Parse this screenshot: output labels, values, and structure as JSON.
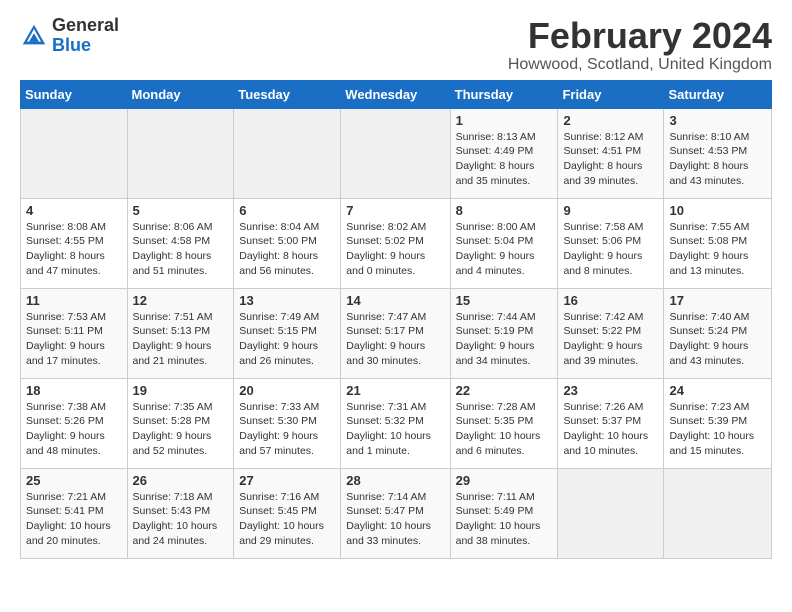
{
  "header": {
    "logo_general": "General",
    "logo_blue": "Blue",
    "month_title": "February 2024",
    "location": "Howwood, Scotland, United Kingdom"
  },
  "days_of_week": [
    "Sunday",
    "Monday",
    "Tuesday",
    "Wednesday",
    "Thursday",
    "Friday",
    "Saturday"
  ],
  "weeks": [
    [
      {
        "day": "",
        "info": ""
      },
      {
        "day": "",
        "info": ""
      },
      {
        "day": "",
        "info": ""
      },
      {
        "day": "",
        "info": ""
      },
      {
        "day": "1",
        "info": "Sunrise: 8:13 AM\nSunset: 4:49 PM\nDaylight: 8 hours and 35 minutes."
      },
      {
        "day": "2",
        "info": "Sunrise: 8:12 AM\nSunset: 4:51 PM\nDaylight: 8 hours and 39 minutes."
      },
      {
        "day": "3",
        "info": "Sunrise: 8:10 AM\nSunset: 4:53 PM\nDaylight: 8 hours and 43 minutes."
      }
    ],
    [
      {
        "day": "4",
        "info": "Sunrise: 8:08 AM\nSunset: 4:55 PM\nDaylight: 8 hours and 47 minutes."
      },
      {
        "day": "5",
        "info": "Sunrise: 8:06 AM\nSunset: 4:58 PM\nDaylight: 8 hours and 51 minutes."
      },
      {
        "day": "6",
        "info": "Sunrise: 8:04 AM\nSunset: 5:00 PM\nDaylight: 8 hours and 56 minutes."
      },
      {
        "day": "7",
        "info": "Sunrise: 8:02 AM\nSunset: 5:02 PM\nDaylight: 9 hours and 0 minutes."
      },
      {
        "day": "8",
        "info": "Sunrise: 8:00 AM\nSunset: 5:04 PM\nDaylight: 9 hours and 4 minutes."
      },
      {
        "day": "9",
        "info": "Sunrise: 7:58 AM\nSunset: 5:06 PM\nDaylight: 9 hours and 8 minutes."
      },
      {
        "day": "10",
        "info": "Sunrise: 7:55 AM\nSunset: 5:08 PM\nDaylight: 9 hours and 13 minutes."
      }
    ],
    [
      {
        "day": "11",
        "info": "Sunrise: 7:53 AM\nSunset: 5:11 PM\nDaylight: 9 hours and 17 minutes."
      },
      {
        "day": "12",
        "info": "Sunrise: 7:51 AM\nSunset: 5:13 PM\nDaylight: 9 hours and 21 minutes."
      },
      {
        "day": "13",
        "info": "Sunrise: 7:49 AM\nSunset: 5:15 PM\nDaylight: 9 hours and 26 minutes."
      },
      {
        "day": "14",
        "info": "Sunrise: 7:47 AM\nSunset: 5:17 PM\nDaylight: 9 hours and 30 minutes."
      },
      {
        "day": "15",
        "info": "Sunrise: 7:44 AM\nSunset: 5:19 PM\nDaylight: 9 hours and 34 minutes."
      },
      {
        "day": "16",
        "info": "Sunrise: 7:42 AM\nSunset: 5:22 PM\nDaylight: 9 hours and 39 minutes."
      },
      {
        "day": "17",
        "info": "Sunrise: 7:40 AM\nSunset: 5:24 PM\nDaylight: 9 hours and 43 minutes."
      }
    ],
    [
      {
        "day": "18",
        "info": "Sunrise: 7:38 AM\nSunset: 5:26 PM\nDaylight: 9 hours and 48 minutes."
      },
      {
        "day": "19",
        "info": "Sunrise: 7:35 AM\nSunset: 5:28 PM\nDaylight: 9 hours and 52 minutes."
      },
      {
        "day": "20",
        "info": "Sunrise: 7:33 AM\nSunset: 5:30 PM\nDaylight: 9 hours and 57 minutes."
      },
      {
        "day": "21",
        "info": "Sunrise: 7:31 AM\nSunset: 5:32 PM\nDaylight: 10 hours and 1 minute."
      },
      {
        "day": "22",
        "info": "Sunrise: 7:28 AM\nSunset: 5:35 PM\nDaylight: 10 hours and 6 minutes."
      },
      {
        "day": "23",
        "info": "Sunrise: 7:26 AM\nSunset: 5:37 PM\nDaylight: 10 hours and 10 minutes."
      },
      {
        "day": "24",
        "info": "Sunrise: 7:23 AM\nSunset: 5:39 PM\nDaylight: 10 hours and 15 minutes."
      }
    ],
    [
      {
        "day": "25",
        "info": "Sunrise: 7:21 AM\nSunset: 5:41 PM\nDaylight: 10 hours and 20 minutes."
      },
      {
        "day": "26",
        "info": "Sunrise: 7:18 AM\nSunset: 5:43 PM\nDaylight: 10 hours and 24 minutes."
      },
      {
        "day": "27",
        "info": "Sunrise: 7:16 AM\nSunset: 5:45 PM\nDaylight: 10 hours and 29 minutes."
      },
      {
        "day": "28",
        "info": "Sunrise: 7:14 AM\nSunset: 5:47 PM\nDaylight: 10 hours and 33 minutes."
      },
      {
        "day": "29",
        "info": "Sunrise: 7:11 AM\nSunset: 5:49 PM\nDaylight: 10 hours and 38 minutes."
      },
      {
        "day": "",
        "info": ""
      },
      {
        "day": "",
        "info": ""
      }
    ]
  ]
}
